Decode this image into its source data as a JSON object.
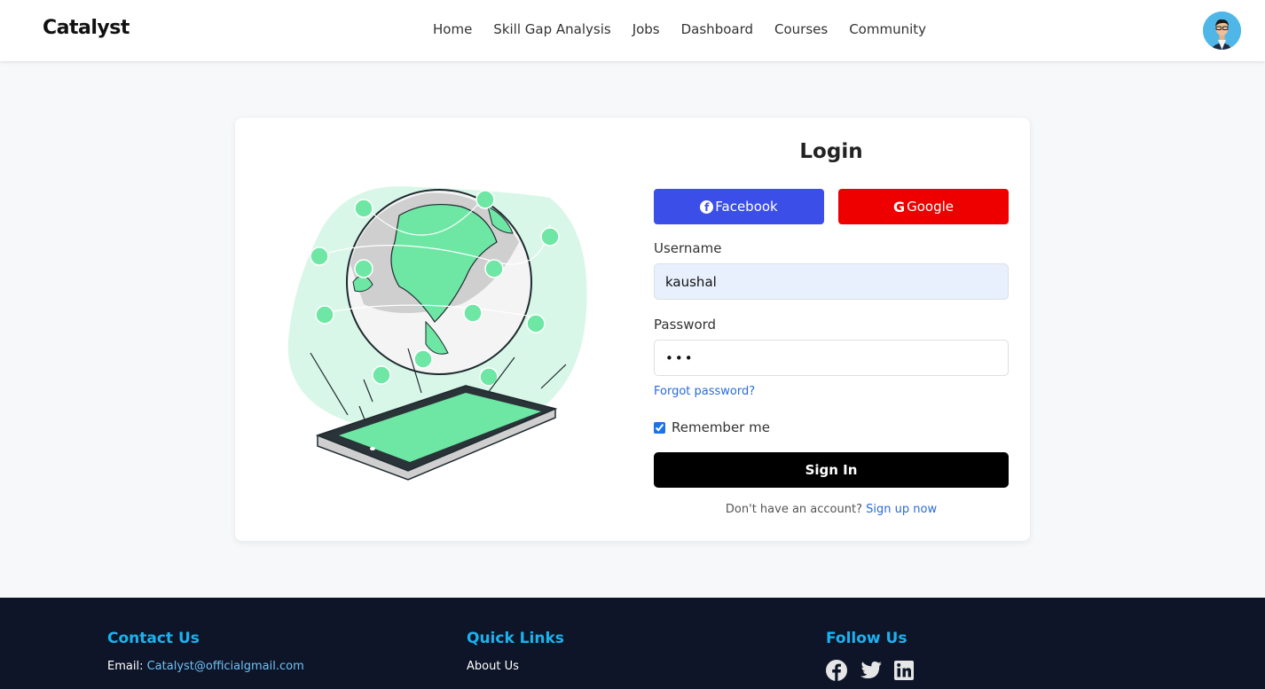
{
  "header": {
    "logo": "Catalyst",
    "nav": [
      "Home",
      "Skill Gap Analysis",
      "Jobs",
      "Dashboard",
      "Courses",
      "Community"
    ]
  },
  "login": {
    "title": "Login",
    "facebook_label": "Facebook",
    "google_label": "Google",
    "username_label": "Username",
    "username_value": "kaushal",
    "password_label": "Password",
    "password_value": "•••",
    "forgot_label": "Forgot password?",
    "remember_label": "Remember me",
    "remember_checked": true,
    "signin_label": "Sign In",
    "no_account_text": "Don't have an account?",
    "signup_label": "Sign up now"
  },
  "footer": {
    "contact_title": "Contact Us",
    "email_label": "Email:",
    "email_value": "Catalyst@officialgmail.com",
    "quick_links_title": "Quick Links",
    "quick_links": [
      "About Us"
    ],
    "follow_title": "Follow Us",
    "social_icons": [
      "facebook-icon",
      "twitter-icon",
      "linkedin-icon"
    ]
  },
  "colors": {
    "facebook": "#3b4ee8",
    "google": "#ee0000",
    "signin": "#000000",
    "footer_bg": "#0e1528",
    "footer_heading": "#1ab3ef",
    "link": "#2a6bd6"
  }
}
